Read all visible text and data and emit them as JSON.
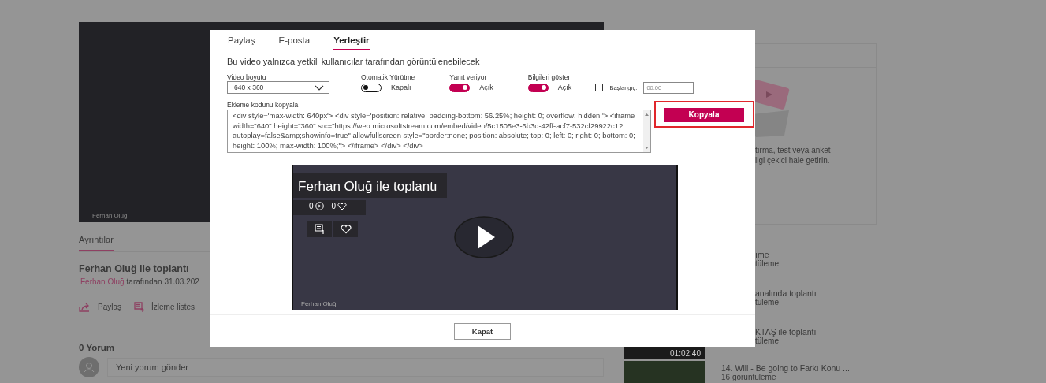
{
  "page": {
    "video_caption": "Ferhan Oluğ",
    "details_tab": {
      "label": "Ayrıntılar",
      "selected": true
    },
    "title": "Ferhan Oluğ ile toplantı",
    "author": "Ferhan Oluğ",
    "byline": "tarafından 31.03.202",
    "actions": [
      {
        "kind": "share",
        "label": "Paylaş"
      },
      {
        "kind": "watchlist",
        "label": "İzleme listes"
      }
    ],
    "comments_count": "0 Yorum",
    "comment_placeholder": "Yeni yorum gönder",
    "promo_lines": [
      "tırma, test veya anket",
      "ilgi çekici hale getirin."
    ],
    "related": [
      {
        "kind": "partial",
        "title": "ıme",
        "views": "tüleme"
      },
      {
        "kind": "partial",
        "title": "analında toplantı",
        "views": "tüleme"
      },
      {
        "kind": "partial",
        "title": "KTAŞ ile toplantı",
        "views": "tüleme",
        "duration": "01:02:40"
      },
      {
        "kind": "full",
        "title": "14. Will - Be going to Farkı Konu ...",
        "views": "16 görüntüleme"
      }
    ]
  },
  "dialog": {
    "tabs": [
      {
        "label": "Paylaş",
        "selected": false
      },
      {
        "label": "E-posta",
        "selected": false
      },
      {
        "label": "Yerleştir",
        "selected": true
      }
    ],
    "notice": "Bu video yalnızca yetkili kullanıcılar tarafından görüntülenebilecek",
    "video_size": {
      "label": "Video boyutu",
      "value": "640 x 360"
    },
    "toggles": [
      {
        "label": "Otomatik Yürütme",
        "on": false,
        "state_text": "Kapalı"
      },
      {
        "label": "Yanıt veriyor",
        "on": true,
        "state_text": "Açık"
      },
      {
        "label": "Bilgileri göster",
        "on": true,
        "state_text": "Açık"
      }
    ],
    "start": {
      "checked": false,
      "label": "Başlangıç:",
      "placeholder": "00:00"
    },
    "embed_code": {
      "label": "Ekleme kodunu kopyala",
      "value": "<div style='max-width: 640px'> <div style='position: relative; padding-bottom: 56.25%; height: 0; overflow: hidden;'> <iframe width=\"640\" height=\"360\" src=\"https://web.microsoftstream.com/embed/video/5c1505e3-6b3d-42ff-acf7-532cf29922c1?autoplay=false&amp;showinfo=true\" allowfullscreen style=\"border:none; position: absolute; top: 0; left: 0; right: 0; bottom: 0; height: 100%; max-width: 100%;\"> </iframe> </div> </div>"
    },
    "copy_button": {
      "label": "Kopyala",
      "highlighted": true
    },
    "preview": {
      "title": "Ferhan Oluğ ile toplantı",
      "views": "0",
      "likes": "0",
      "caption": "Ferhan Oluğ"
    },
    "close_button": "Kapat"
  }
}
